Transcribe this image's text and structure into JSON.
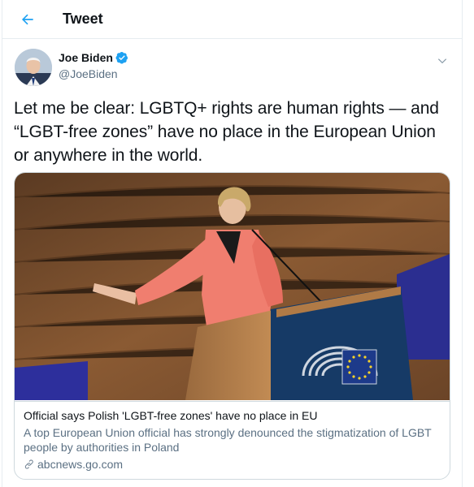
{
  "topbar": {
    "title": "Tweet"
  },
  "author": {
    "name": "Joe Biden",
    "handle": "@JoeBiden",
    "verified": true
  },
  "tweet": {
    "text": "Let me be clear: LGBTQ+ rights are human rights — and “LGBT-free zones” have no place in the European Union or anywhere in the world."
  },
  "card": {
    "title": "Official says Polish 'LGBT-free zones' have no place in EU",
    "description": "A top European Union official has strongly denounced the stigmatization of LGBT people by authorities in Poland",
    "domain": "abcnews.go.com"
  },
  "colors": {
    "accent": "#1da1f2",
    "secondary_text": "#5b7083",
    "border": "#e6ecf0"
  },
  "icons": {
    "back": "arrow-left-icon",
    "verified": "verified-badge-icon",
    "more": "chevron-down-icon",
    "link": "link-icon"
  }
}
